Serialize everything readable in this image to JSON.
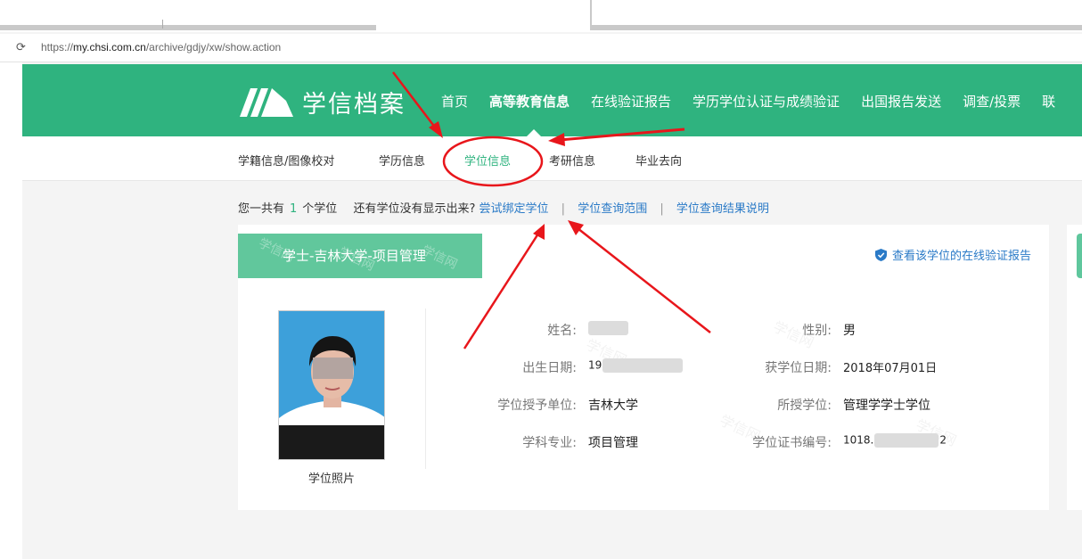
{
  "browser": {
    "url_prefix": "https://",
    "url_host": "my.chsi.com.cn",
    "url_path": "/archive/gdjy/xw/show.action",
    "reload_glyph": "⟳"
  },
  "header": {
    "logo_text": "学信档案",
    "nav": [
      "首页",
      "高等教育信息",
      "在线验证报告",
      "学历学位认证与成绩验证",
      "出国报告发送",
      "调查/投票",
      "联"
    ]
  },
  "subnav": {
    "items": [
      "学籍信息/图像校对",
      "学历信息",
      "学位信息",
      "考研信息",
      "毕业去向"
    ],
    "active": "学位信息"
  },
  "summary": {
    "prefix": "您一共有",
    "count": "1",
    "suffix": "个学位",
    "question": "还有学位没有显示出来?",
    "link_bind": "尝试绑定学位",
    "link_scope": "学位查询范围",
    "link_explain": "学位查询结果说明",
    "separator": "|"
  },
  "card": {
    "title": "学士-吉林大学-项目管理",
    "verify_link": "查看该学位的在线验证报告",
    "watermark": "学信网",
    "photo_caption": "学位照片",
    "fields": {
      "name_label": "姓名:",
      "birth_label": "出生日期:",
      "birth_value": "19",
      "grantor_label": "学位授予单位:",
      "grantor_value": "吉林大学",
      "major_label": "学科专业:",
      "major_value": "项目管理",
      "gender_label": "性别:",
      "gender_value": "男",
      "date_label": "获学位日期:",
      "date_value": "2018年07月01日",
      "degree_label": "所授学位:",
      "degree_value": "管理学学士学位",
      "cert_label": "学位证书编号:",
      "cert_value_start": "1018.",
      "cert_value_end": "2"
    }
  },
  "colors": {
    "brand_green": "#2fb37f",
    "tag_green": "#61c79c",
    "link_blue": "#2a7ac7",
    "annotation_red": "#e8161b"
  }
}
